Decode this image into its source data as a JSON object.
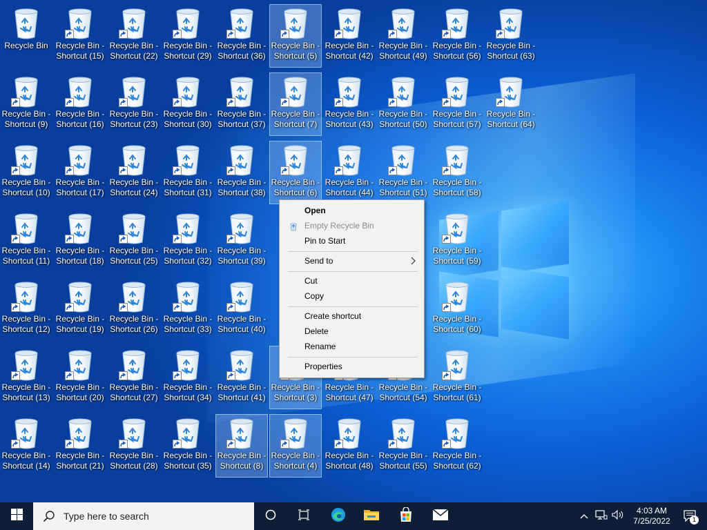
{
  "desktop": {
    "icons": [
      {
        "label": "Recycle Bin",
        "shortcut": false,
        "selected": false
      },
      {
        "label": "Recycle Bin - Shortcut (15)",
        "shortcut": true,
        "selected": false
      },
      {
        "label": "Recycle Bin - Shortcut (22)",
        "shortcut": true,
        "selected": false
      },
      {
        "label": "Recycle Bin - Shortcut (29)",
        "shortcut": true,
        "selected": false
      },
      {
        "label": "Recycle Bin - Shortcut (36)",
        "shortcut": true,
        "selected": false
      },
      {
        "label": "Recycle Bin - Shortcut (5)",
        "shortcut": true,
        "selected": true
      },
      {
        "label": "Recycle Bin - Shortcut (42)",
        "shortcut": true,
        "selected": false
      },
      {
        "label": "Recycle Bin - Shortcut (49)",
        "shortcut": true,
        "selected": false
      },
      {
        "label": "Recycle Bin - Shortcut (56)",
        "shortcut": true,
        "selected": false
      },
      {
        "label": "Recycle Bin - Shortcut (63)",
        "shortcut": true,
        "selected": false
      },
      {
        "label": "Recycle Bin - Shortcut (9)",
        "shortcut": true,
        "selected": false
      },
      {
        "label": "Recycle Bin - Shortcut (16)",
        "shortcut": true,
        "selected": false
      },
      {
        "label": "Recycle Bin - Shortcut (23)",
        "shortcut": true,
        "selected": false
      },
      {
        "label": "Recycle Bin - Shortcut (30)",
        "shortcut": true,
        "selected": false
      },
      {
        "label": "Recycle Bin - Shortcut (37)",
        "shortcut": true,
        "selected": false
      },
      {
        "label": "Recycle Bin - Shortcut (7)",
        "shortcut": true,
        "selected": true
      },
      {
        "label": "Recycle Bin - Shortcut (43)",
        "shortcut": true,
        "selected": false
      },
      {
        "label": "Recycle Bin - Shortcut (50)",
        "shortcut": true,
        "selected": false
      },
      {
        "label": "Recycle Bin - Shortcut (57)",
        "shortcut": true,
        "selected": false
      },
      {
        "label": "Recycle Bin - Shortcut (64)",
        "shortcut": true,
        "selected": false
      },
      {
        "label": "Recycle Bin - Shortcut (10)",
        "shortcut": true,
        "selected": false
      },
      {
        "label": "Recycle Bin - Shortcut (17)",
        "shortcut": true,
        "selected": false
      },
      {
        "label": "Recycle Bin - Shortcut (24)",
        "shortcut": true,
        "selected": false
      },
      {
        "label": "Recycle Bin - Shortcut (31)",
        "shortcut": true,
        "selected": false
      },
      {
        "label": "Recycle Bin - Shortcut (38)",
        "shortcut": true,
        "selected": false
      },
      {
        "label": "Recycle Bin - Shortcut (6)",
        "shortcut": true,
        "selected": true
      },
      {
        "label": "Recycle Bin - Shortcut (44)",
        "shortcut": true,
        "selected": false
      },
      {
        "label": "Recycle Bin - Shortcut (51)",
        "shortcut": true,
        "selected": false
      },
      {
        "label": "Recycle Bin - Shortcut (58)",
        "shortcut": true,
        "selected": false
      },
      {
        "label": "Recycle Bin - Shortcut (11)",
        "shortcut": true,
        "selected": false
      },
      {
        "label": "Recycle Bin - Shortcut (18)",
        "shortcut": true,
        "selected": false
      },
      {
        "label": "Recycle Bin - Shortcut (25)",
        "shortcut": true,
        "selected": false
      },
      {
        "label": "Recycle Bin - Shortcut (32)",
        "shortcut": true,
        "selected": false
      },
      {
        "label": "Recycle Bin - Shortcut (39)",
        "shortcut": true,
        "selected": false
      },
      {
        "label": "Recycle Bin - Shortcut (59)",
        "shortcut": true,
        "selected": false
      },
      {
        "label": "Recycle Bin - Shortcut (12)",
        "shortcut": true,
        "selected": false
      },
      {
        "label": "Recycle Bin - Shortcut (19)",
        "shortcut": true,
        "selected": false
      },
      {
        "label": "Recycle Bin - Shortcut (26)",
        "shortcut": true,
        "selected": false
      },
      {
        "label": "Recycle Bin - Shortcut (33)",
        "shortcut": true,
        "selected": false
      },
      {
        "label": "Recycle Bin - Shortcut (40)",
        "shortcut": true,
        "selected": false
      },
      {
        "label": "Recycle Bin - Shortcut (60)",
        "shortcut": true,
        "selected": false
      },
      {
        "label": "Recycle Bin - Shortcut (13)",
        "shortcut": true,
        "selected": false
      },
      {
        "label": "Recycle Bin - Shortcut (20)",
        "shortcut": true,
        "selected": false
      },
      {
        "label": "Recycle Bin - Shortcut (27)",
        "shortcut": true,
        "selected": false
      },
      {
        "label": "Recycle Bin - Shortcut (34)",
        "shortcut": true,
        "selected": false
      },
      {
        "label": "Recycle Bin - Shortcut (41)",
        "shortcut": true,
        "selected": false
      },
      {
        "label": "Recycle Bin - Shortcut (3)",
        "shortcut": true,
        "selected": true
      },
      {
        "label": "Recycle Bin - Shortcut (47)",
        "shortcut": true,
        "selected": false
      },
      {
        "label": "Recycle Bin - Shortcut (54)",
        "shortcut": true,
        "selected": false
      },
      {
        "label": "Recycle Bin - Shortcut (61)",
        "shortcut": true,
        "selected": false
      },
      {
        "label": "Recycle Bin - Shortcut (14)",
        "shortcut": true,
        "selected": false
      },
      {
        "label": "Recycle Bin - Shortcut (21)",
        "shortcut": true,
        "selected": false
      },
      {
        "label": "Recycle Bin - Shortcut (28)",
        "shortcut": true,
        "selected": false
      },
      {
        "label": "Recycle Bin - Shortcut (35)",
        "shortcut": true,
        "selected": false
      },
      {
        "label": "Recycle Bin - Shortcut (8)",
        "shortcut": true,
        "selected": true
      },
      {
        "label": "Recycle Bin - Shortcut (4)",
        "shortcut": true,
        "selected": true
      },
      {
        "label": "Recycle Bin - Shortcut (48)",
        "shortcut": true,
        "selected": false
      },
      {
        "label": "Recycle Bin - Shortcut (55)",
        "shortcut": true,
        "selected": false
      },
      {
        "label": "Recycle Bin - Shortcut (62)",
        "shortcut": true,
        "selected": false
      }
    ]
  },
  "context_menu": {
    "open": "Open",
    "empty_recycle_bin": "Empty Recycle Bin",
    "pin_to_start": "Pin to Start",
    "send_to": "Send to",
    "cut": "Cut",
    "copy": "Copy",
    "create_shortcut": "Create shortcut",
    "delete": "Delete",
    "rename": "Rename",
    "properties": "Properties",
    "submenu_arrow": ">"
  },
  "taskbar": {
    "search_placeholder": "Type here to search",
    "time": "4:03 AM",
    "date": "7/25/2022",
    "notification_count": "1",
    "icons": [
      "windows-logo-icon",
      "search-icon",
      "cortana-icon",
      "task-view-icon",
      "edge-icon",
      "file-explorer-icon",
      "microsoft-store-icon",
      "mail-icon",
      "chevron-up-icon",
      "network-icon",
      "volume-icon",
      "action-center-icon"
    ]
  },
  "colors": {
    "desktop_blue": "#0b5fd6",
    "taskbar": "#0d1e37",
    "menu_bg": "#f2f2f2"
  }
}
